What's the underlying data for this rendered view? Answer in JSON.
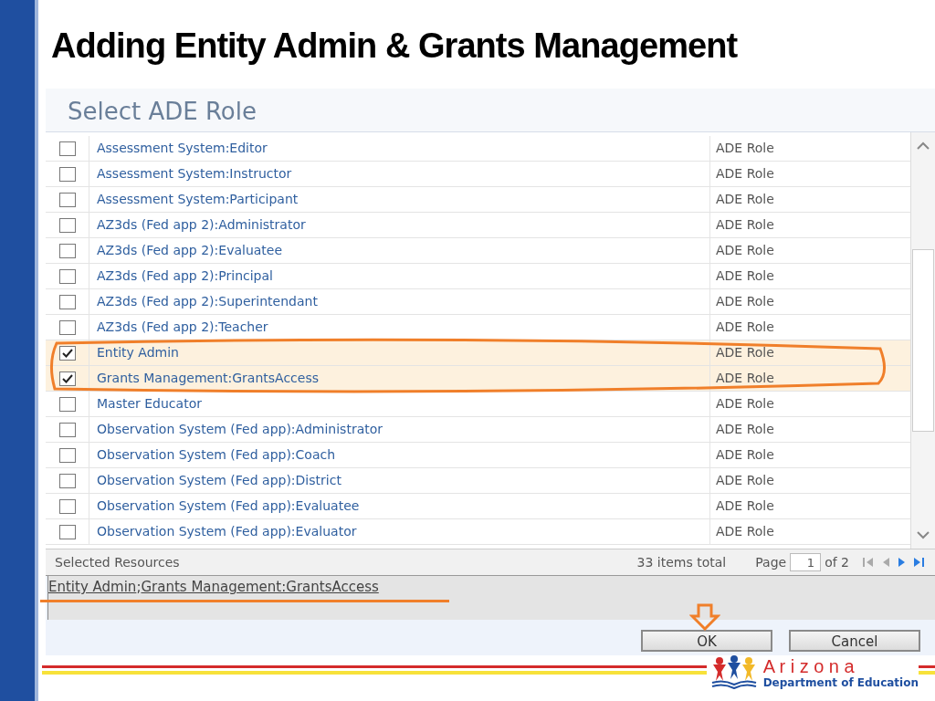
{
  "slide_title": "Adding Entity Admin & Grants Management",
  "dialog": {
    "title": "Select ADE Role",
    "rows": [
      {
        "name": "Assessment System:Editor",
        "type": "ADE Role",
        "checked": false
      },
      {
        "name": "Assessment System:Instructor",
        "type": "ADE Role",
        "checked": false
      },
      {
        "name": "Assessment System:Participant",
        "type": "ADE Role",
        "checked": false
      },
      {
        "name": "AZ3ds (Fed app 2):Administrator",
        "type": "ADE Role",
        "checked": false
      },
      {
        "name": "AZ3ds (Fed app 2):Evaluatee",
        "type": "ADE Role",
        "checked": false
      },
      {
        "name": "AZ3ds (Fed app 2):Principal",
        "type": "ADE Role",
        "checked": false
      },
      {
        "name": "AZ3ds (Fed app 2):Superintendant",
        "type": "ADE Role",
        "checked": false
      },
      {
        "name": "AZ3ds (Fed app 2):Teacher",
        "type": "ADE Role",
        "checked": false
      },
      {
        "name": "Entity Admin",
        "type": "ADE Role",
        "checked": true
      },
      {
        "name": "Grants Management:GrantsAccess",
        "type": "ADE Role",
        "checked": true
      },
      {
        "name": "Master Educator",
        "type": "ADE Role",
        "checked": false
      },
      {
        "name": "Observation System (Fed app):Administrator",
        "type": "ADE Role",
        "checked": false
      },
      {
        "name": "Observation System (Fed app):Coach",
        "type": "ADE Role",
        "checked": false
      },
      {
        "name": "Observation System (Fed app):District",
        "type": "ADE Role",
        "checked": false
      },
      {
        "name": "Observation System (Fed app):Evaluatee",
        "type": "ADE Role",
        "checked": false
      },
      {
        "name": "Observation System (Fed app):Evaluator",
        "type": "ADE Role",
        "checked": false
      }
    ],
    "footer": {
      "label": "Selected Resources",
      "total": "33 items total",
      "page_label": "Page",
      "page_value": "1",
      "page_of": "of 2"
    },
    "selected_links": [
      "Entity Admin",
      "Grants Management:GrantsAccess"
    ],
    "separator": ";",
    "buttons": [
      "OK",
      "Cancel"
    ]
  },
  "logo": {
    "name": "A r i z o n a",
    "subtitle": "Department of Education"
  }
}
